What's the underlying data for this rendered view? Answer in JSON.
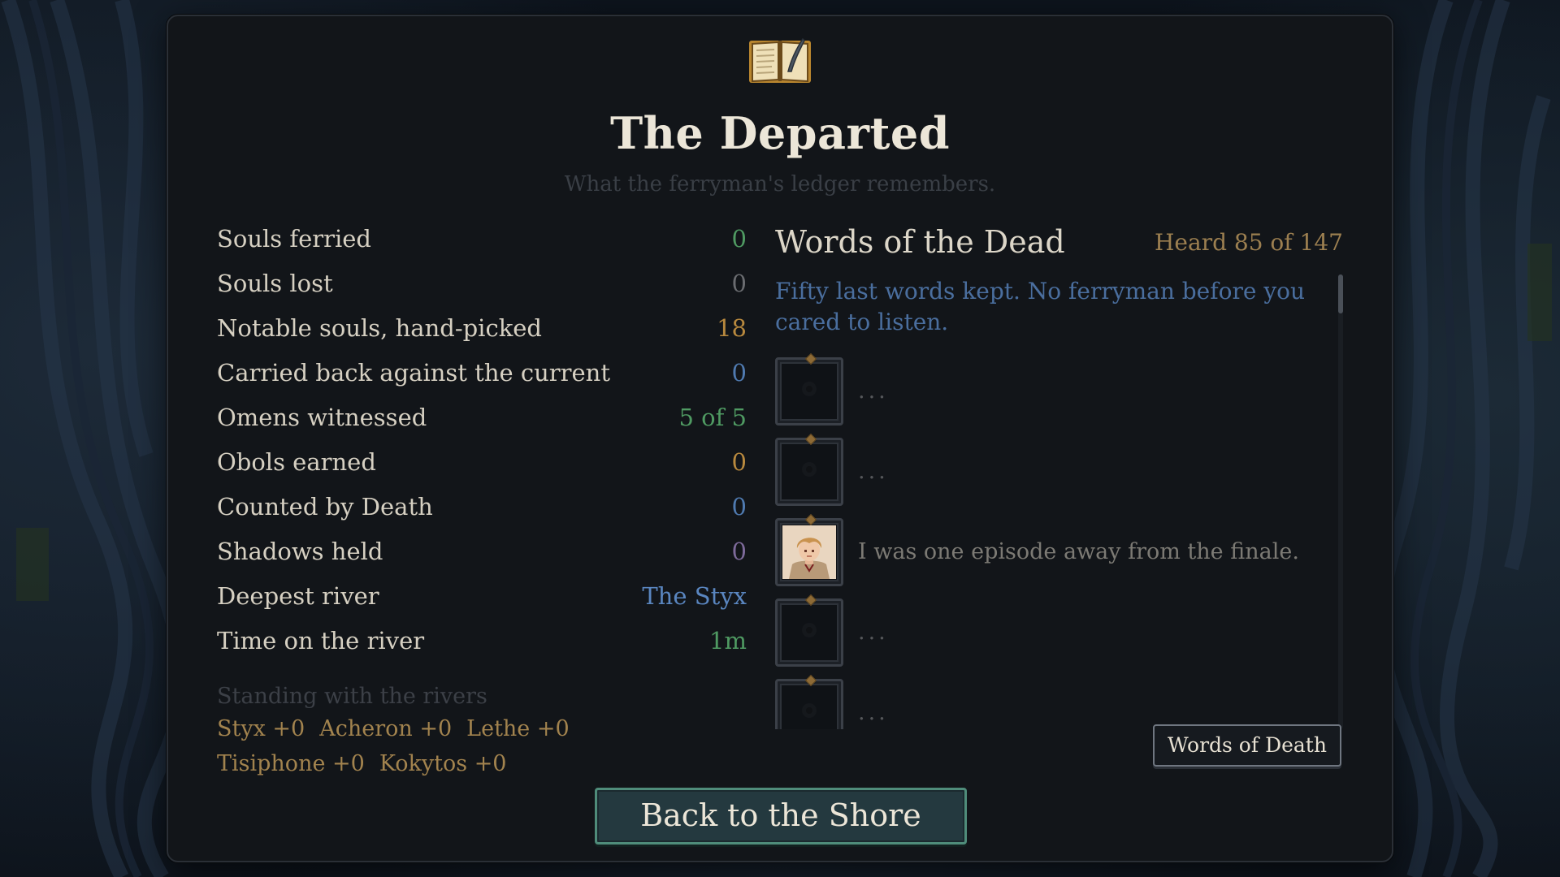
{
  "header": {
    "title": "The Departed",
    "subtitle": "What the ferryman's ledger remembers."
  },
  "stats": [
    {
      "label": "Souls ferried",
      "value": "0",
      "color": "#4f9a62"
    },
    {
      "label": "Souls lost",
      "value": "0",
      "color": "#6a6c70"
    },
    {
      "label": "Notable souls, hand-picked",
      "value": "18",
      "color": "#b8893e"
    },
    {
      "label": "Carried back against the current",
      "value": "0",
      "color": "#4f7ab0"
    },
    {
      "label": "Omens witnessed",
      "value": "5 of 5",
      "color": "#4f9a62"
    },
    {
      "label": "Obols earned",
      "value": "0",
      "color": "#b8893e"
    },
    {
      "label": "Counted by Death",
      "value": "0",
      "color": "#4f7ab0"
    },
    {
      "label": "Shadows held",
      "value": "0",
      "color": "#7d6a9a"
    },
    {
      "label": "Deepest river",
      "value": "The Styx",
      "color": "#5a86c0"
    },
    {
      "label": "Time on the river",
      "value": "1m",
      "color": "#4f9a62"
    }
  ],
  "standing": {
    "heading": "Standing with the rivers",
    "items": [
      "Styx +0",
      "Acheron +0",
      "Lethe +0",
      "Tisiphone +0",
      "Kokytos +0"
    ]
  },
  "words": {
    "title": "Words of the Dead",
    "count": "Heard 85 of 147",
    "intro": "Fifty last words kept. No ferryman before you cared to listen.",
    "entries": [
      {
        "text": "...",
        "portrait": "locked-soul"
      },
      {
        "text": "...",
        "portrait": "locked-soul"
      },
      {
        "text": "I was one episode away from the finale.",
        "portrait": "blond-soul"
      },
      {
        "text": "...",
        "portrait": "locked-soul"
      },
      {
        "text": "...",
        "portrait": "locked-soul"
      }
    ],
    "death_button": "Words of Death"
  },
  "footer": {
    "back_button": "Back to the Shore"
  },
  "colors": {
    "accent_green": "#4f8c7a",
    "gold": "#b8893e",
    "blue": "#4f7ab0"
  }
}
